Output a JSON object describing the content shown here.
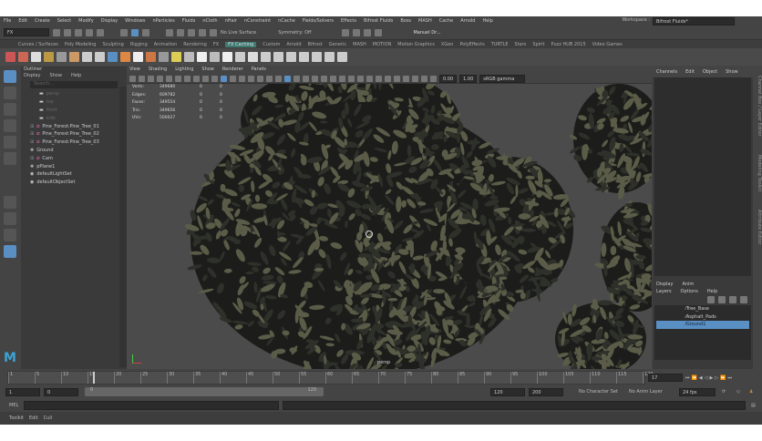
{
  "menubar": [
    "File",
    "Edit",
    "Create",
    "Select",
    "Modify",
    "Display",
    "Windows",
    "nParticles",
    "Fluids",
    "nCloth",
    "nHair",
    "nConstraint",
    "nCache",
    "Fields/Solvers",
    "Effects",
    "Bifrost Fluids",
    "Boss",
    "MASH",
    "Cache",
    "Arnold",
    "Help"
  ],
  "workspace": {
    "label": "Workspace :",
    "value": "Bifrost Fluids*"
  },
  "status": {
    "mode": "FX",
    "live_surface": "No Live Surface",
    "symmetry": "Symmetry: Off",
    "user": "Manuel Dr..."
  },
  "shelf_tabs": [
    "Curves / Surfaces",
    "Poly Modeling",
    "Sculpting",
    "Rigging",
    "Animation",
    "Rendering",
    "FX",
    "FX Caching",
    "Custom",
    "Arnold",
    "Bifrost",
    "Generic",
    "MASH",
    "MOTION",
    "Motion Graphics",
    "XGen",
    "PolyEffects",
    "TURTLE",
    "Stars",
    "Spirit",
    "Puzz HUB 2015",
    "Video Games"
  ],
  "shelf_active": "FX Caching",
  "outliner": {
    "title": "Outliner",
    "menu": [
      "Display",
      "Show",
      "Help"
    ],
    "search_placeholder": "Search...",
    "items": [
      {
        "label": "persp",
        "type": "camera"
      },
      {
        "label": "top",
        "type": "camera"
      },
      {
        "label": "front",
        "type": "camera"
      },
      {
        "label": "side",
        "type": "camera"
      },
      {
        "label": "Pine_Forest:Pine_Tree_01",
        "type": "group"
      },
      {
        "label": "Pine_Forest:Pine_Tree_02",
        "type": "group"
      },
      {
        "label": "Pine_Forest:Pine_Tree_03",
        "type": "group"
      },
      {
        "label": "Ground",
        "type": "transform"
      },
      {
        "label": "Cam",
        "type": "group"
      },
      {
        "label": "pPlane1",
        "type": "transform"
      },
      {
        "label": "defaultLightSet",
        "type": "set"
      },
      {
        "label": "defaultObjectSet",
        "type": "set"
      }
    ]
  },
  "viewport": {
    "menu": [
      "View",
      "Shading",
      "Lighting",
      "Show",
      "Renderer",
      "Panels"
    ],
    "exposure": "0.00",
    "gamma": "1.00",
    "color_space": "sRGB gamma",
    "camera": "persp",
    "hud": [
      {
        "label": "Verts:",
        "value": "349680",
        "c1": "0",
        "c2": "0"
      },
      {
        "label": "Edges:",
        "value": "609782",
        "c1": "0",
        "c2": "0"
      },
      {
        "label": "Faces:",
        "value": "349554",
        "c1": "0",
        "c2": "0"
      },
      {
        "label": "Tris:",
        "value": "349656",
        "c1": "0",
        "c2": "0"
      },
      {
        "label": "UVs:",
        "value": "500027",
        "c1": "0",
        "c2": "0"
      }
    ]
  },
  "channel_box": {
    "menu": [
      "Channels",
      "Edit",
      "Object",
      "Show"
    ]
  },
  "layers": {
    "tabs": [
      "Display",
      "Anim"
    ],
    "menu": [
      "Layers",
      "Options",
      "Help"
    ],
    "items": [
      {
        "label": "Tree_Base",
        "selected": false
      },
      {
        "label": "Asphalt_Pads",
        "selected": false
      },
      {
        "label": "Ground1",
        "selected": true
      }
    ]
  },
  "side_tabs": [
    "Channel Box / Layer Editor",
    "Modeling Toolkit",
    "Attribute Editor"
  ],
  "time": {
    "current": "17",
    "ticks": [
      "1",
      "5",
      "10",
      "15",
      "20",
      "25",
      "30",
      "35",
      "40",
      "45",
      "50",
      "55",
      "60",
      "65",
      "70",
      "75",
      "80",
      "85",
      "90",
      "95",
      "100",
      "105",
      "110",
      "115",
      "120"
    ]
  },
  "range": {
    "start": "1",
    "inner_start": "0",
    "slider_start": "0",
    "slider_end": "120",
    "end": "120",
    "outer_end": "200",
    "character_set": "No Character Set",
    "anim_layer": "No Anim Layer",
    "fps": "24 fps"
  },
  "cmd": {
    "label": "MEL"
  },
  "help": [
    "Toolkit",
    "Edit",
    "Cull"
  ],
  "accent": "#5a8fc4"
}
